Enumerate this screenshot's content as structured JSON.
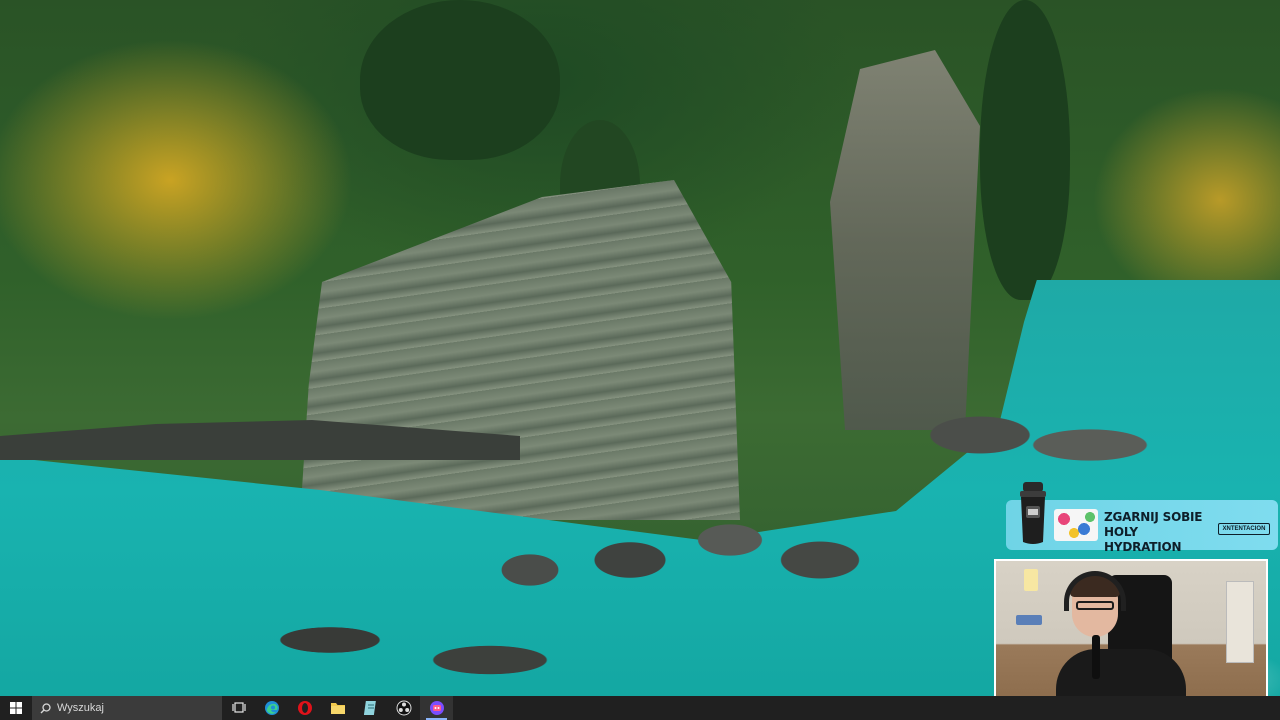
{
  "taskbar": {
    "search_placeholder": "Wyszukaj",
    "apps": [
      {
        "name": "task-view",
        "icon": "task-view-icon"
      },
      {
        "name": "edge",
        "icon": "edge-icon"
      },
      {
        "name": "opera",
        "icon": "opera-icon"
      },
      {
        "name": "file-explorer",
        "icon": "folder-icon"
      },
      {
        "name": "notepad",
        "icon": "notepad-icon"
      },
      {
        "name": "obs-studio",
        "icon": "obs-icon"
      },
      {
        "name": "streamlabs",
        "icon": "streamlabs-icon"
      }
    ],
    "accent_color": "#8ab4f8",
    "background_color": "#202020"
  },
  "promo_banner": {
    "headline_line1": "ZGARNIJ SOBIE",
    "headline_line2": "HOLY HYDRATION",
    "brand": "XNTENTACION",
    "background_color": "#7fdcef"
  },
  "webcam": {
    "border_color": "#ffffff"
  },
  "colors": {
    "river": "#19b3b0",
    "foliage_gold": "#c9a323",
    "forest": "#2a5326"
  }
}
